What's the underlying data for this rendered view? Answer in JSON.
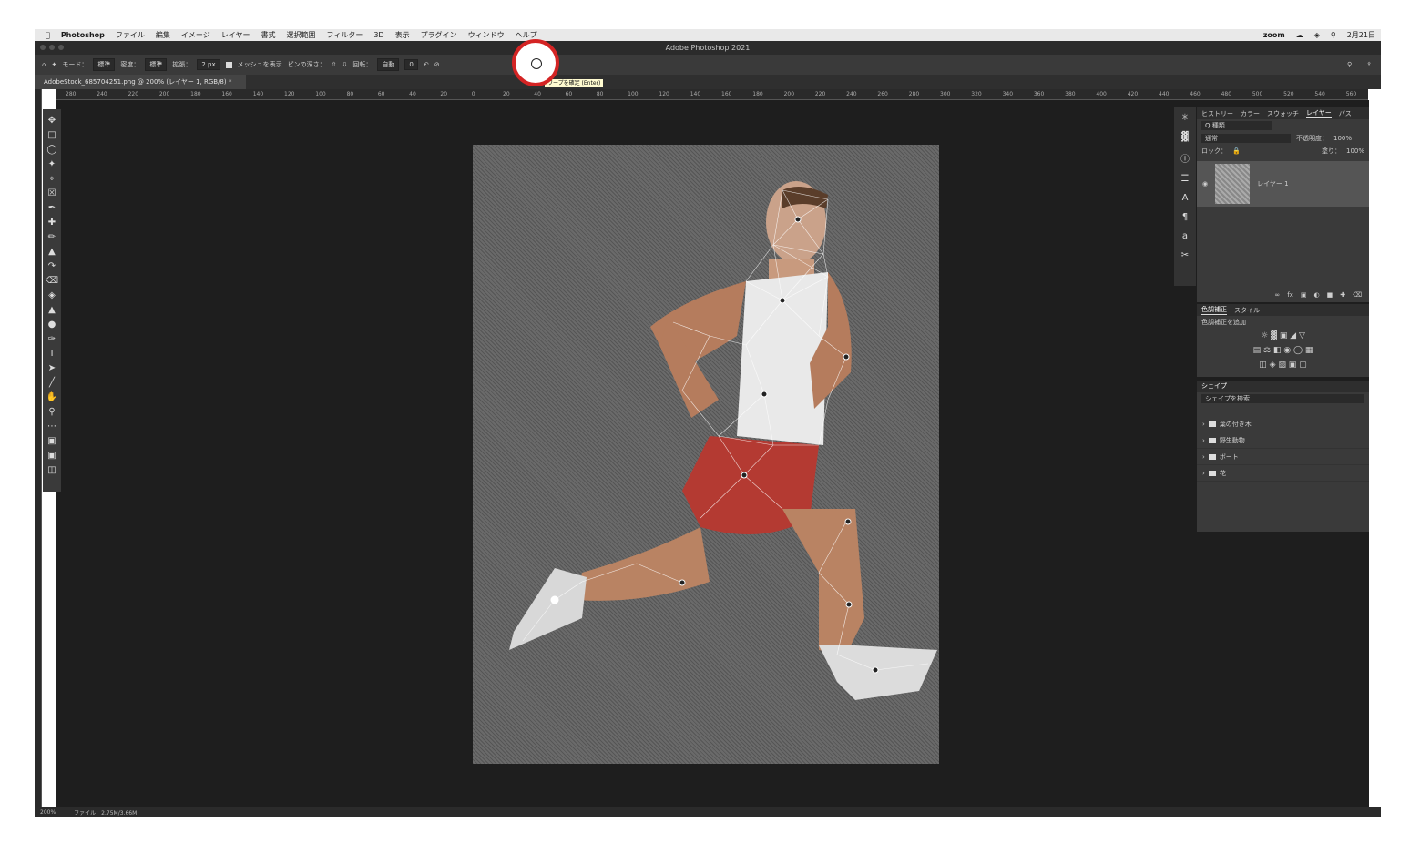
{
  "menubar": {
    "apple": "",
    "app": "Photoshop",
    "items": [
      "ファイル",
      "編集",
      "イメージ",
      "レイヤー",
      "書式",
      "選択範囲",
      "フィルター",
      "3D",
      "表示",
      "プラグイン",
      "ウィンドウ",
      "ヘルプ"
    ],
    "zoom": "zoom",
    "date": "2月21日"
  },
  "titlebar": {
    "title": "Adobe Photoshop 2021"
  },
  "options": {
    "mode_label": "モード：",
    "mode_value": "標準",
    "density_label": "密度：",
    "density_value": "標準",
    "expand_label": "拡張：",
    "expand_value": "2 px",
    "show_mesh": "メッシュを表示",
    "pin_depth": "ピンの深さ：",
    "rotate_label": "回転：",
    "rotate_value": "自動",
    "rotate_deg": "0"
  },
  "tooltip": "ワープを確定 (Enter)",
  "doc": {
    "tab": "AdobeStock_685704251.png @ 200% (レイヤー 1, RGB/8) *"
  },
  "ruler": {
    "ticks": [
      "280",
      "240",
      "220",
      "200",
      "180",
      "160",
      "140",
      "120",
      "100",
      "80",
      "60",
      "40",
      "20",
      "0",
      "20",
      "40",
      "60",
      "80",
      "100",
      "120",
      "140",
      "160",
      "180",
      "200",
      "220",
      "240",
      "260",
      "280",
      "300",
      "320",
      "340",
      "360",
      "380",
      "400",
      "420",
      "440",
      "460",
      "480",
      "500",
      "520",
      "540",
      "560"
    ]
  },
  "status": {
    "zoom": "200%",
    "file": "ファイル：2.75M/3.66M"
  },
  "layers_panel": {
    "tabs": [
      "ヒストリー",
      "カラー",
      "スウォッチ",
      "レイヤー",
      "パス"
    ],
    "active": "レイヤー",
    "search": "Q 種類",
    "blend": "通常",
    "opacity_label": "不透明度：",
    "opacity": "100%",
    "lock_label": "ロック：",
    "fill_label": "塗り：",
    "fill": "100%",
    "layer_name": "レイヤー 1"
  },
  "adjust_panel": {
    "tabs": [
      "色調補正",
      "スタイル"
    ],
    "add_label": "色調補正を追加"
  },
  "shapes_panel": {
    "title": "シェイプ",
    "search": "シェイプを検索",
    "folders": [
      "葉の付き木",
      "野生動物",
      "ボート",
      "花"
    ]
  },
  "colors": {
    "accent": "#d42424",
    "bg": "#1e1e1e",
    "panel": "#3a3a3a"
  }
}
